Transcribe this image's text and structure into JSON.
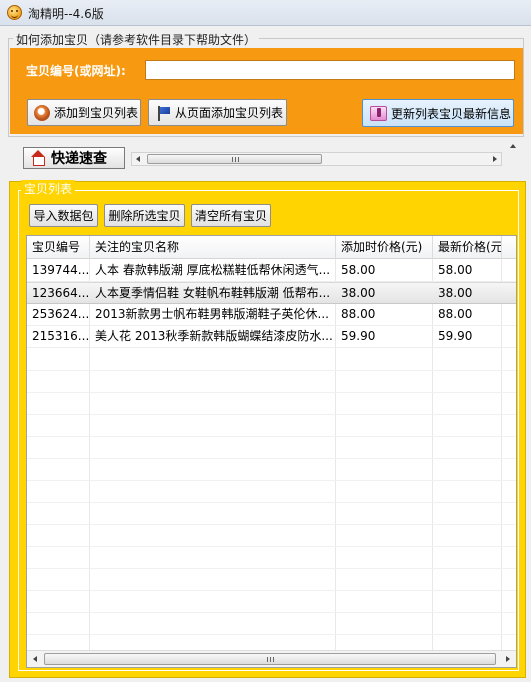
{
  "window": {
    "title": "淘精明--4.6版"
  },
  "add_section": {
    "group_label": "如何添加宝贝（请参考软件目录下帮助文件）",
    "id_label": "宝贝编号(或网址):",
    "id_value": "",
    "add_to_list_button": "添加到宝贝列表",
    "add_from_page_button": "从页面添加宝贝列表",
    "refresh_button": "更新列表宝贝最新信息",
    "accent_color": "#f79a12"
  },
  "express": {
    "button_label": "快递速查"
  },
  "list_section": {
    "group_label": "宝贝列表",
    "accent_color": "#ffd400",
    "toolbar": {
      "import_button": "导入数据包",
      "delete_selected_button": "删除所选宝贝",
      "clear_all_button": "清空所有宝贝"
    },
    "columns": [
      "宝贝编号",
      "关注的宝贝名称",
      "添加时价格(元)",
      "最新价格(元)"
    ],
    "rows": [
      {
        "id": "139744...",
        "name": "人本 春款韩版潮 厚底松糕鞋低帮休闲透气...",
        "added_price": "58.00",
        "latest_price": "58.00"
      },
      {
        "id": "123664...",
        "name": "人本夏季情侣鞋 女鞋帆布鞋韩版潮 低帮布...",
        "added_price": "38.00",
        "latest_price": "38.00"
      },
      {
        "id": "253624...",
        "name": "2013新款男士帆布鞋男韩版潮鞋子英伦休...",
        "added_price": "88.00",
        "latest_price": "88.00"
      },
      {
        "id": "215316...",
        "name": "美人花 2013秋季新款韩版蝴蝶结漆皮防水...",
        "added_price": "59.90",
        "latest_price": "59.90"
      }
    ],
    "selected_row_index": 1
  }
}
